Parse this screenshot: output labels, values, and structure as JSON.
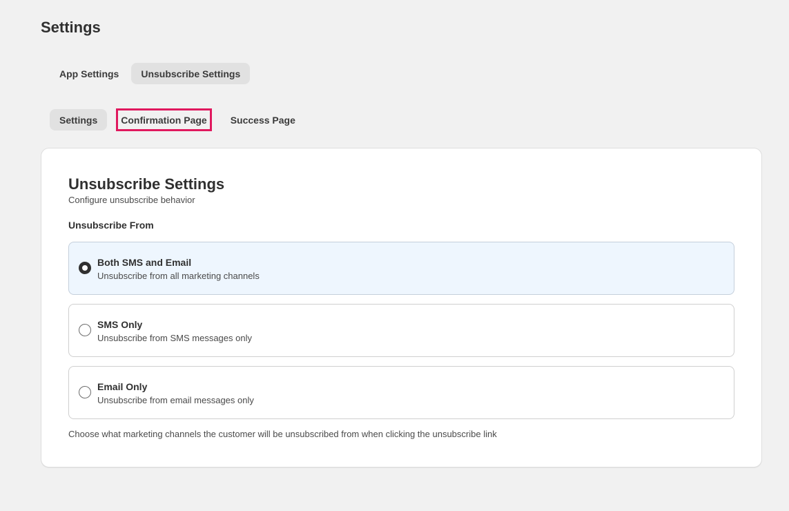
{
  "header": {
    "title": "Settings"
  },
  "main_tabs": [
    {
      "label": "App Settings",
      "active": false
    },
    {
      "label": "Unsubscribe Settings",
      "active": true
    }
  ],
  "sub_tabs": [
    {
      "label": "Settings",
      "active": true
    },
    {
      "label": "Confirmation Page",
      "active": false,
      "highlighted": true
    },
    {
      "label": "Success Page",
      "active": false
    }
  ],
  "card": {
    "title": "Unsubscribe Settings",
    "subtitle": "Configure unsubscribe behavior",
    "section_label": "Unsubscribe From",
    "options": [
      {
        "title": "Both SMS and Email",
        "description": "Unsubscribe from all marketing channels",
        "selected": true
      },
      {
        "title": "SMS Only",
        "description": "Unsubscribe from SMS messages only",
        "selected": false
      },
      {
        "title": "Email Only",
        "description": "Unsubscribe from email messages only",
        "selected": false
      }
    ],
    "help_text": "Choose what marketing channels the customer will be unsubscribed from when clicking the unsubscribe link"
  },
  "colors": {
    "background": "#f1f1f1",
    "active_tab": "#e1e1e1",
    "highlight_outline": "#e0185e",
    "selected_option_bg": "#eef6fe"
  }
}
